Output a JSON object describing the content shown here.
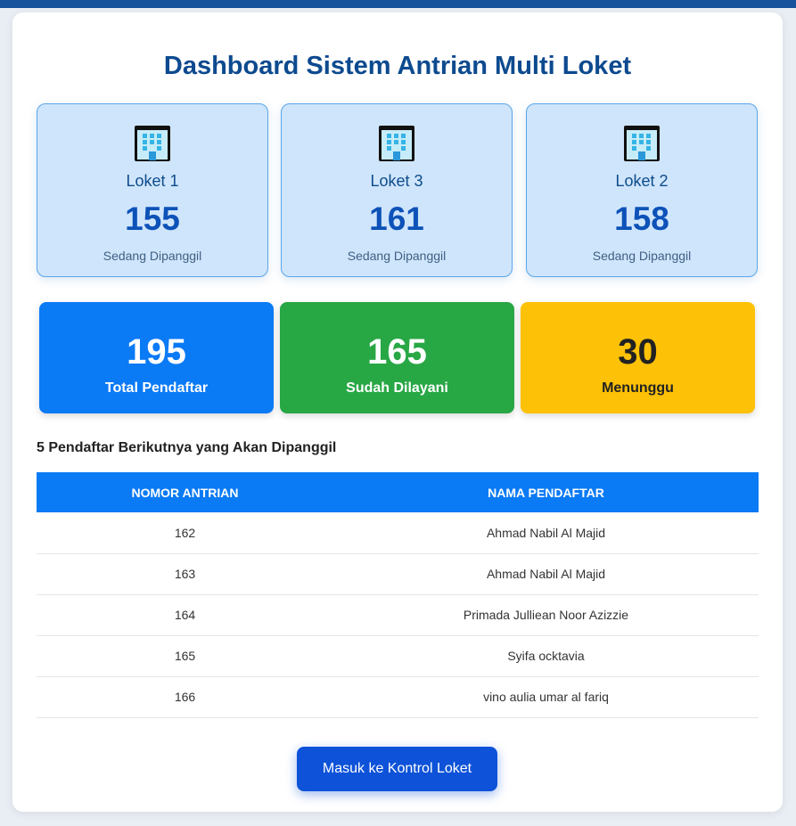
{
  "title": "Dashboard Sistem Antrian Multi Loket",
  "lokets": [
    {
      "name": "Loket 1",
      "number": "155",
      "status": "Sedang Dipanggil"
    },
    {
      "name": "Loket 3",
      "number": "161",
      "status": "Sedang Dipanggil"
    },
    {
      "name": "Loket 2",
      "number": "158",
      "status": "Sedang Dipanggil"
    }
  ],
  "stats": {
    "total": {
      "value": "195",
      "label": "Total Pendaftar",
      "color": "#0a7af5"
    },
    "served": {
      "value": "165",
      "label": "Sudah Dilayani",
      "color": "#28a745"
    },
    "waiting": {
      "value": "30",
      "label": "Menunggu",
      "color": "#fdc107"
    }
  },
  "queue": {
    "heading": "5 Pendaftar Berikutnya yang Akan Dipanggil",
    "columns": [
      "NOMOR ANTRIAN",
      "NAMA PENDAFTAR"
    ],
    "rows": [
      {
        "number": "162",
        "name": "Ahmad Nabil Al Majid"
      },
      {
        "number": "163",
        "name": "Ahmad Nabil Al Majid"
      },
      {
        "number": "164",
        "name": "Primada Julliean Noor Azizzie"
      },
      {
        "number": "165",
        "name": "Syifa ocktavia"
      },
      {
        "number": "166",
        "name": "vino aulia umar al fariq"
      }
    ]
  },
  "button_label": "Masuk ke Kontrol Loket",
  "icons": {
    "loket": "building-icon"
  },
  "colors": {
    "brand": "#16539c",
    "accent": "#0a7af5",
    "button": "#0d52d8"
  }
}
